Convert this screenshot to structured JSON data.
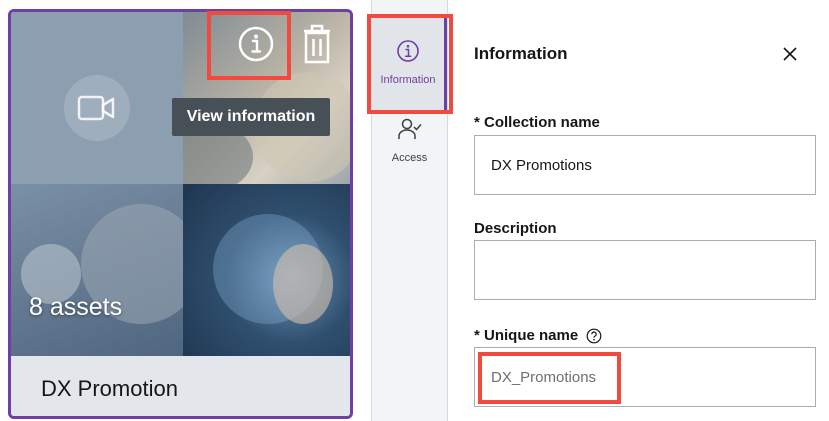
{
  "card": {
    "title": "DX Promotion",
    "assets_count": "8 assets",
    "info_icon": "info-circle-icon",
    "trash_icon": "trash-icon",
    "video_icon": "video-camera-icon",
    "tooltip": "View information"
  },
  "rail": {
    "items": [
      {
        "label": "Information",
        "icon": "info-circle-icon",
        "active": true
      },
      {
        "label": "Access",
        "icon": "user-access-icon",
        "active": false
      }
    ]
  },
  "panel": {
    "title": "Information",
    "close_icon": "close-icon",
    "fields": {
      "collection_name": {
        "required_mark": "*",
        "label": "Collection name",
        "value": "DX Promotions"
      },
      "description": {
        "label": "Description",
        "value": ""
      },
      "unique_name": {
        "required_mark": "*",
        "label": "Unique name",
        "value": "DX_Promotions",
        "help_icon": "help-circle-icon"
      }
    }
  },
  "colors": {
    "accent": "#6f3fa3",
    "highlight": "#f04b3e",
    "tooltip_bg": "#474f57"
  }
}
